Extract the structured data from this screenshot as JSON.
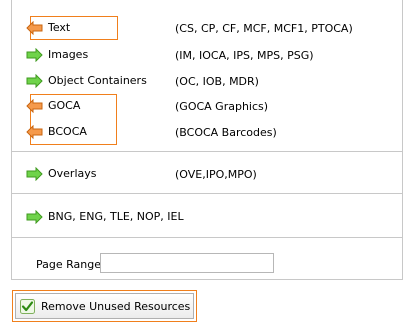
{
  "rows": [
    {
      "label": "Text",
      "desc": "(CS, CP, CF, MCF, MCF1, PTOCA)",
      "arrow": "left-orange-arrow-icon"
    },
    {
      "label": "Images",
      "desc": "(IM, IOCA, IPS, MPS, PSG)",
      "arrow": "right-green-arrow-icon"
    },
    {
      "label": "Object Containers",
      "desc": "(OC, IOB, MDR)",
      "arrow": "right-green-arrow-icon"
    },
    {
      "label": "GOCA",
      "desc": "(GOCA Graphics)",
      "arrow": "left-orange-arrow-icon"
    },
    {
      "label": "BCOCA",
      "desc": "(BCOCA Barcodes)",
      "arrow": "left-orange-arrow-icon"
    },
    {
      "label": "Overlays",
      "desc": "(OVE,IPO,MPO)",
      "arrow": "right-green-arrow-icon"
    },
    {
      "label": "BNG, ENG, TLE, NOP, IEL",
      "desc": "",
      "arrow": "right-green-arrow-icon"
    }
  ],
  "page_range": {
    "label": "Page Range:",
    "value": ""
  },
  "remove_button": {
    "label": "Remove Unused Resources",
    "checked": true
  },
  "colors": {
    "highlight": "#f07f1c",
    "green_arrow": "#58c234",
    "orange_arrow": "#f07f1c"
  }
}
